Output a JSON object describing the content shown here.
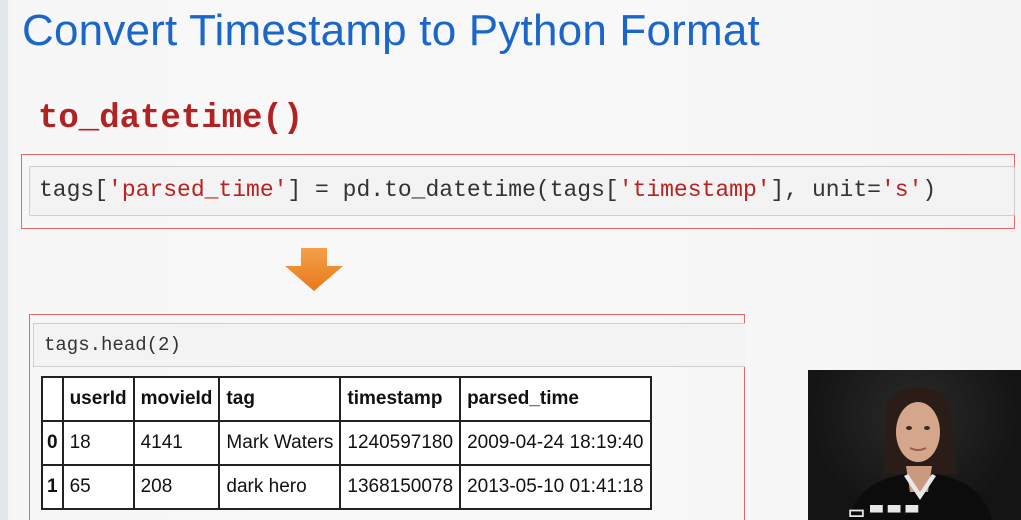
{
  "slide": {
    "title": "Convert Timestamp to Python Format",
    "func_heading": "to_datetime()"
  },
  "code1": {
    "p1": "tags[",
    "s1": "'parsed_time'",
    "p2": "] = pd.to_datetime(tags[",
    "s2": "'timestamp'",
    "p3": "], unit=",
    "s3": "'s'",
    "p4": ")"
  },
  "code2": {
    "p1": "tags.head(",
    "n1": "2",
    "p2": ")"
  },
  "table": {
    "headers": [
      "",
      "userId",
      "movieId",
      "tag",
      "timestamp",
      "parsed_time"
    ],
    "rows": [
      {
        "index": "0",
        "userId": "18",
        "movieId": "4141",
        "tag": "Mark Waters",
        "timestamp": "1240597180",
        "parsed_time": "2009-04-24 18:19:40"
      },
      {
        "index": "1",
        "userId": "65",
        "movieId": "208",
        "tag": "dark hero",
        "timestamp": "1368150078",
        "parsed_time": "2013-05-10 01:41:18"
      }
    ]
  },
  "colors": {
    "title_blue": "#1b66c9",
    "heading_red": "#b22222",
    "string_red": "#ba2121",
    "arrow_orange": "#f08c2a",
    "box_border": "#e06a6a"
  },
  "icons": {
    "arrow": "down-arrow-icon"
  }
}
